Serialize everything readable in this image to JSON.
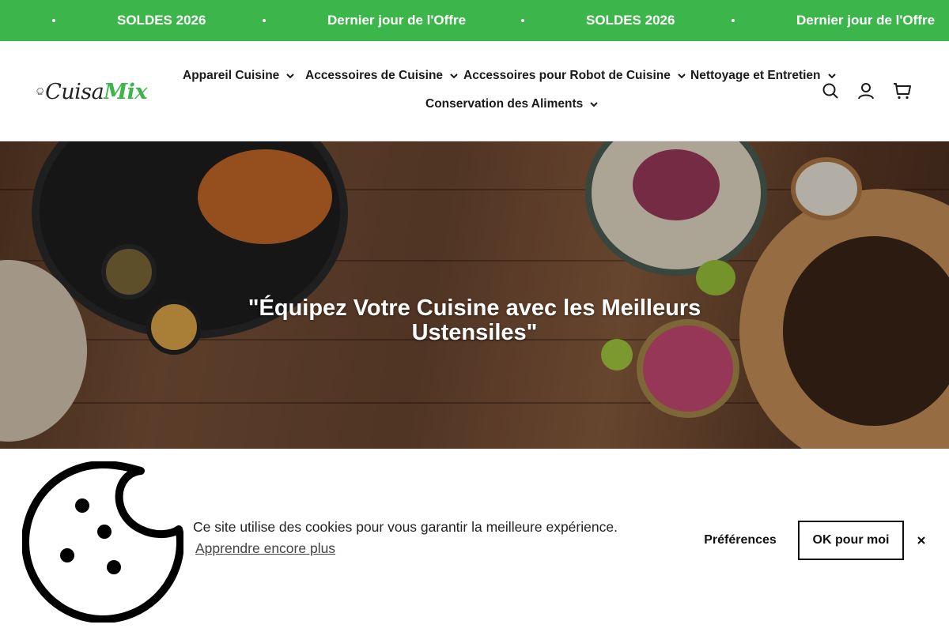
{
  "announcement": {
    "messages": [
      "SOLDES 2026",
      "Dernier jour de l'Offre",
      "SOLDES 2026",
      "Dernier jour de l'Offre"
    ]
  },
  "header": {
    "logo": {
      "part1": "Cuisa",
      "part2": "Mix"
    },
    "nav": [
      {
        "label": "Appareil Cuisine"
      },
      {
        "label": "Accessoires de Cuisine"
      },
      {
        "label": "Accessoires pour Robot de Cuisine"
      },
      {
        "label": "Nettoyage et Entretien"
      },
      {
        "label": "Conservation des Aliments"
      }
    ],
    "icons": [
      "search-icon",
      "account-icon",
      "cart-icon"
    ]
  },
  "hero": {
    "title": "\"Équipez Votre Cuisine avec les Meilleurs Ustensiles\""
  },
  "cookie": {
    "message": "Ce site utilise des cookies pour vous garantir la meilleure expérience.",
    "learn_more": "Apprendre encore plus",
    "preferences": "Préférences",
    "accept": "OK pour moi"
  },
  "colors": {
    "brand_green": "#3cb54a",
    "text": "#1a1a1a"
  }
}
